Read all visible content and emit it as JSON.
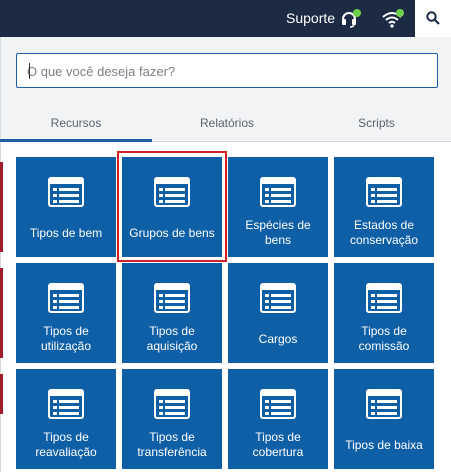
{
  "header": {
    "support_label": "Suporte",
    "support_icon": "headset-icon",
    "wifi_icon": "wifi-icon",
    "search_icon": "search-icon",
    "status_color": "#6ed04a"
  },
  "search": {
    "placeholder": "O que você deseja fazer?",
    "value": ""
  },
  "tabs": [
    {
      "label": "Recursos",
      "active": true
    },
    {
      "label": "Relatórios",
      "active": false
    },
    {
      "label": "Scripts",
      "active": false
    }
  ],
  "tiles": [
    {
      "label": "Tipos de bem",
      "icon": "list-icon"
    },
    {
      "label": "Grupos de bens",
      "icon": "list-icon",
      "highlighted": true
    },
    {
      "label": "Espécies de bens",
      "icon": "list-icon"
    },
    {
      "label": "Estados de conservação",
      "icon": "list-icon"
    },
    {
      "label": "Tipos de utilização",
      "icon": "list-icon"
    },
    {
      "label": "Tipos de aquisição",
      "icon": "list-icon"
    },
    {
      "label": "Cargos",
      "icon": "list-icon"
    },
    {
      "label": "Tipos de comissão",
      "icon": "list-icon"
    },
    {
      "label": "Tipos de reavaliação",
      "icon": "list-icon"
    },
    {
      "label": "Tipos de transferência",
      "icon": "list-icon"
    },
    {
      "label": "Tipos de cobertura",
      "icon": "list-icon"
    },
    {
      "label": "Tipos de baixa",
      "icon": "list-icon"
    }
  ],
  "colors": {
    "topbar": "#1d2a44",
    "tile": "#0f5fa7",
    "accent": "#1f5fa6",
    "highlight": "#d0202a"
  }
}
